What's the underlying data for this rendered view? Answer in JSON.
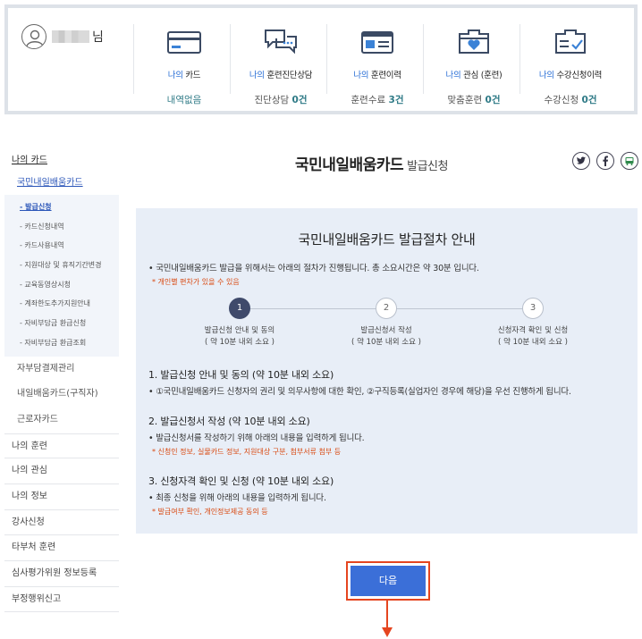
{
  "user": {
    "suffix": "님"
  },
  "stats": [
    {
      "my": "나의",
      "title": " 카드",
      "value_text": "내역없음",
      "value_num": "",
      "value_unit": ""
    },
    {
      "my": "나의",
      "title": " 훈련진단상담",
      "value_text": "진단상담 ",
      "value_num": "0",
      "value_unit": "건"
    },
    {
      "my": "나의",
      "title": " 훈련이력",
      "value_text": "훈련수료 ",
      "value_num": "3",
      "value_unit": "건"
    },
    {
      "my": "나의",
      "title": " 관심 (훈련)",
      "value_text": "맞춤훈련 ",
      "value_num": "0",
      "value_unit": "건"
    },
    {
      "my": "나의",
      "title": " 수강신청이력",
      "value_text": "수강신청 ",
      "value_num": "0",
      "value_unit": "건"
    }
  ],
  "nav": {
    "head": "나의 카드",
    "sub_head": "국민내일배움카드",
    "sub_items": [
      "- 발급신청",
      "- 카드신청내역",
      "- 카드사용내역",
      "- 지원대상 및 휴직기간변경",
      "- 교육동영상시청",
      "- 계좌한도추가지원안내",
      "- 자비부담금 환급신청",
      "- 자비부담금 환급조회"
    ],
    "items_inner": [
      "자부담결제관리",
      "내일배움카드(구직자)",
      "근로자카드"
    ],
    "items": [
      "나의 훈련",
      "나의 관심",
      "나의 정보",
      "강사신청",
      "타부처 훈련",
      "심사평가위원 정보등록",
      "부정행위신고"
    ]
  },
  "header": {
    "title": "국민내일배움카드",
    "subtitle": "발급신청"
  },
  "share": [
    "twitter-icon",
    "facebook-icon",
    "bus-icon"
  ],
  "guide": {
    "title": "국민내일배움카드 발급절차 안내",
    "intro": "• 국민내일배움카드 발급을 위해서는 아래의 절차가 진행됩니다. 총 소요시간은 약 30분 입니다.",
    "note": "* 개인별 편차가 있을 수 있음",
    "steps": [
      {
        "num": "1",
        "label": "발급신청 안내 및 동의",
        "time": "( 약 10분 내외 소요 )"
      },
      {
        "num": "2",
        "label": "발급신청서 작성",
        "time": "( 약 10분 내외 소요 )"
      },
      {
        "num": "3",
        "label": "신청자격 확인 및 신청",
        "time": "( 약 10분 내외 소요 )"
      }
    ],
    "sections": [
      {
        "title": "1. 발급신청 안내 및 동의 (약 10분 내외 소요)",
        "desc": "• ①국민내일배움카드 신청자의 권리 및 의무사항에 대한 확인, ②구직등록(실업자인 경우에 해당)을 우선 진행하게 됩니다.",
        "note": ""
      },
      {
        "title": "2. 발급신청서 작성 (약 10분 내외 소요)",
        "desc": "• 발급신청서를 작성하기 위해 아래의 내용을 입력하게 됩니다.",
        "note": "* 신청인 정보, 실물카드 정보, 지원대상 구분, 첨부서류 첨부 등"
      },
      {
        "title": "3. 신청자격 확인 및 신청 (약 10분 내외 소요)",
        "desc": "• 최종 신청을 위해 아래의 내용을 입력하게 됩니다.",
        "note": "* 발급여부 확인, 개인정보제공 동의 등"
      }
    ]
  },
  "next_button": "다음",
  "colors": {
    "accent_blue": "#3b6fd8",
    "highlight_red": "#e5451f",
    "panel_bg": "#e8eef7",
    "value_teal": "#2e7a86"
  }
}
